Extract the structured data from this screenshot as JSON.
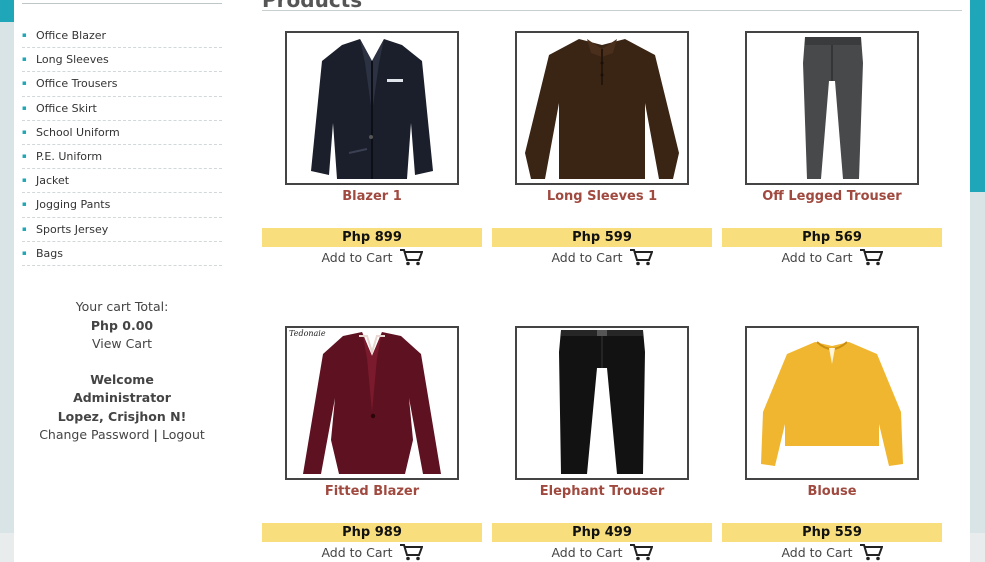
{
  "sidebar": {
    "items": [
      {
        "label": "Office Blazer"
      },
      {
        "label": "Long Sleeves"
      },
      {
        "label": "Office Trousers"
      },
      {
        "label": "Office Skirt"
      },
      {
        "label": "School Uniform"
      },
      {
        "label": "P.E. Uniform"
      },
      {
        "label": "Jacket"
      },
      {
        "label": "Jogging Pants"
      },
      {
        "label": "Sports Jersey"
      },
      {
        "label": "Bags"
      }
    ]
  },
  "cart": {
    "total_label": "Your cart Total:",
    "total_value": "Php 0.00",
    "view_cart": "View Cart"
  },
  "user": {
    "welcome": "Welcome",
    "role": "Administrator",
    "name": "Lopez, Crisjhon N!",
    "change_password": "Change Password",
    "separator": "|",
    "logout": "Logout"
  },
  "main": {
    "heading": "Products",
    "add_to_cart_label": "Add to Cart",
    "products": [
      {
        "name": "Blazer 1",
        "price": "Php 899",
        "image": "navy-blazer"
      },
      {
        "name": "Long Sleeves 1",
        "price": "Php 599",
        "image": "brown-long-sleeve-polo"
      },
      {
        "name": "Off Legged Trouser",
        "price": "Php 569",
        "image": "gray-trouser"
      },
      {
        "name": "Fitted Blazer",
        "price": "Php 989",
        "image": "maroon-fitted-blazer",
        "watermark": "Tedonaie"
      },
      {
        "name": "Elephant Trouser",
        "price": "Php 499",
        "image": "black-trouser"
      },
      {
        "name": "Blouse",
        "price": "Php 559",
        "image": "yellow-blouse"
      }
    ]
  },
  "colors": {
    "accent": "#1fa6b8",
    "product_name": "#a0493f",
    "price_band": "#f9de7d"
  },
  "icons": {
    "cart": "shopping-cart-icon",
    "bullet": "bullet-icon"
  }
}
